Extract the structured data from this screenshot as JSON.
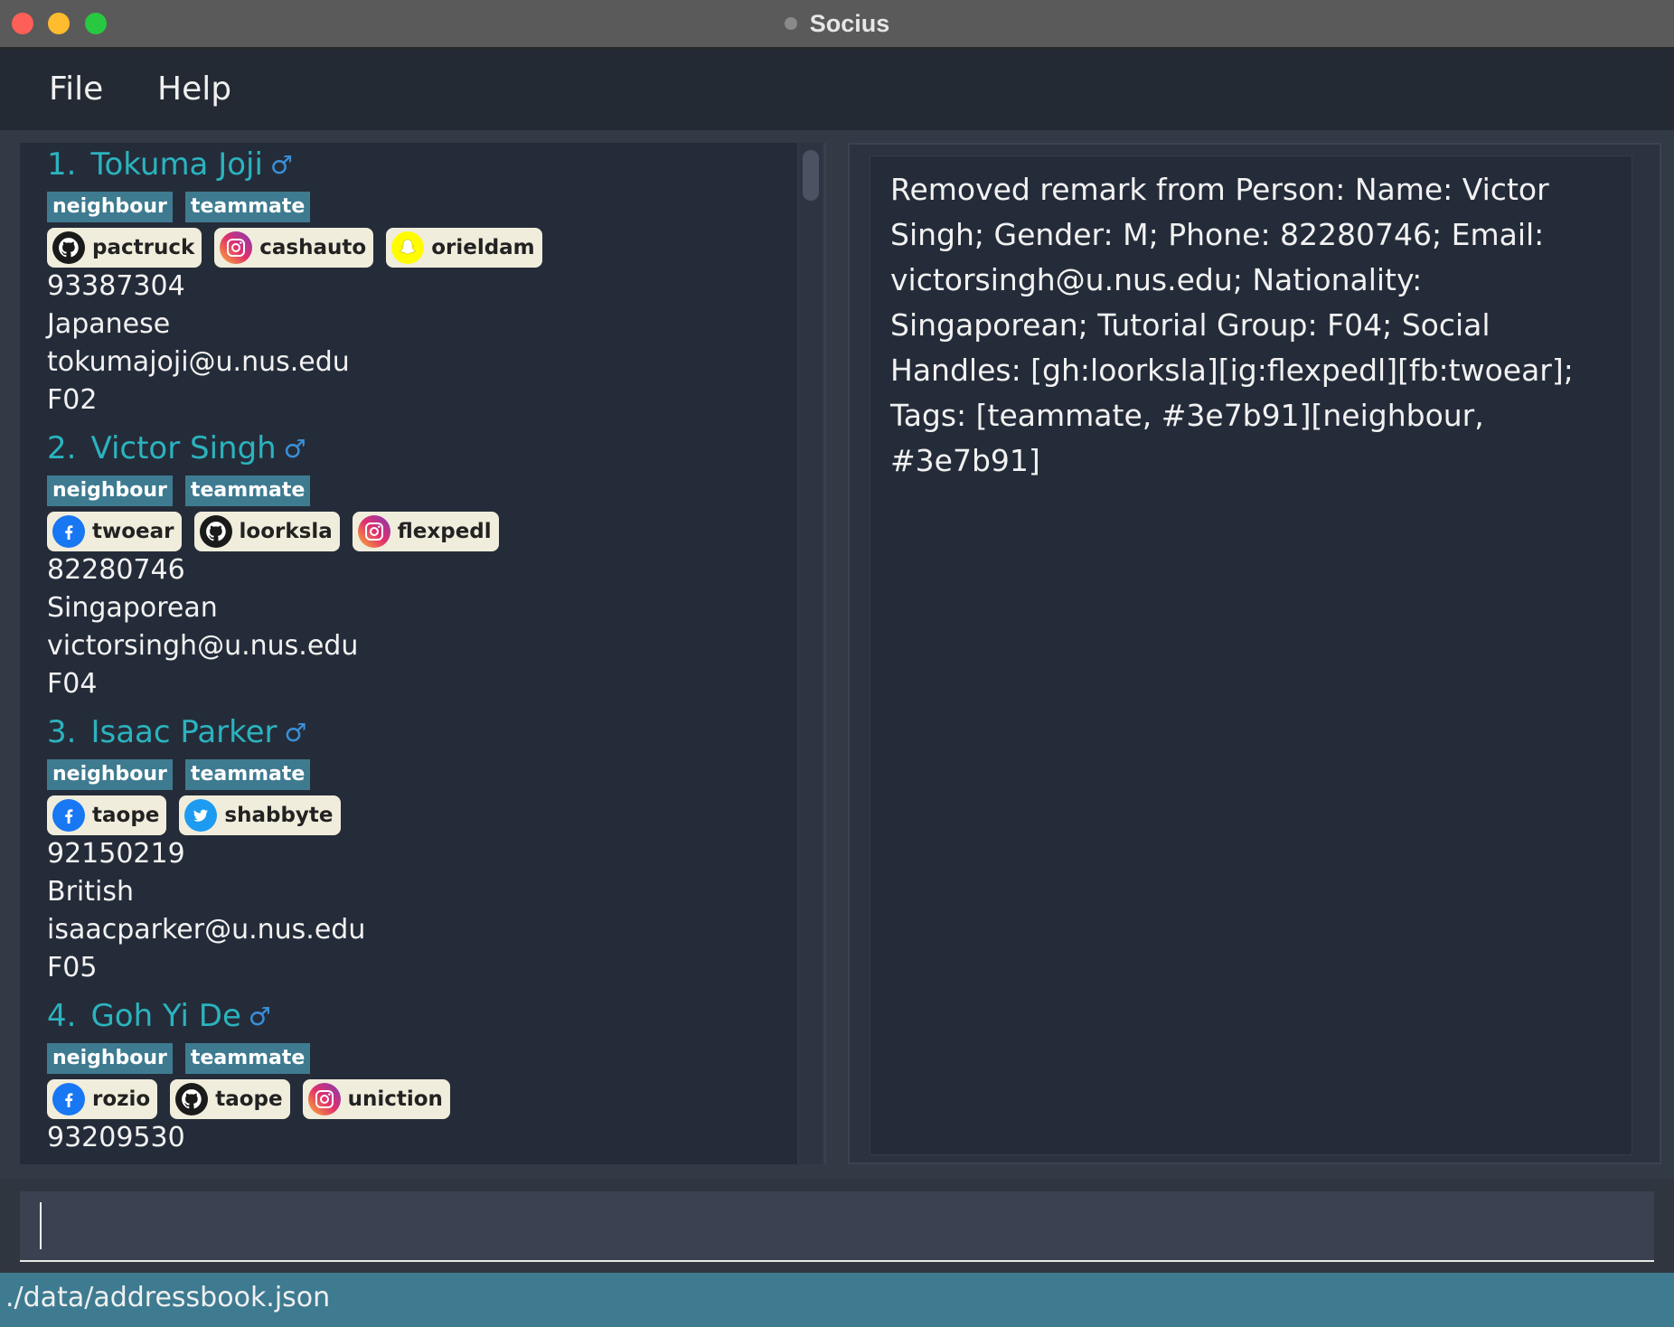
{
  "window": {
    "title": "Socius"
  },
  "menu": {
    "file": "File",
    "help": "Help"
  },
  "persons": [
    {
      "index": "1.",
      "name": "Tokuma Joji",
      "gender_icon": "male-icon",
      "tags": [
        "neighbour",
        "teammate"
      ],
      "socials": [
        {
          "platform": "github",
          "icon": "github-icon",
          "handle": "pactruck"
        },
        {
          "platform": "instagram",
          "icon": "instagram-icon",
          "handle": "cashauto"
        },
        {
          "platform": "snapchat",
          "icon": "snapchat-icon",
          "handle": "orieldam"
        }
      ],
      "phone": "93387304",
      "nationality": "Japanese",
      "email": "tokumajoji@u.nus.edu",
      "tutorial": "F02"
    },
    {
      "index": "2.",
      "name": "Victor Singh",
      "gender_icon": "male-icon",
      "tags": [
        "neighbour",
        "teammate"
      ],
      "socials": [
        {
          "platform": "facebook",
          "icon": "facebook-icon",
          "handle": "twoear"
        },
        {
          "platform": "github",
          "icon": "github-icon",
          "handle": "loorksla"
        },
        {
          "platform": "instagram",
          "icon": "instagram-icon",
          "handle": "flexpedl"
        }
      ],
      "phone": "82280746",
      "nationality": "Singaporean",
      "email": "victorsingh@u.nus.edu",
      "tutorial": "F04"
    },
    {
      "index": "3.",
      "name": "Isaac Parker",
      "gender_icon": "male-icon",
      "tags": [
        "neighbour",
        "teammate"
      ],
      "socials": [
        {
          "platform": "facebook",
          "icon": "facebook-icon",
          "handle": "taope"
        },
        {
          "platform": "twitter",
          "icon": "twitter-icon",
          "handle": "shabbyte"
        }
      ],
      "phone": "92150219",
      "nationality": "British",
      "email": "isaacparker@u.nus.edu",
      "tutorial": "F05"
    },
    {
      "index": "4.",
      "name": "Goh Yi De",
      "gender_icon": "male-icon",
      "tags": [
        "neighbour",
        "teammate"
      ],
      "socials": [
        {
          "platform": "facebook",
          "icon": "facebook-icon",
          "handle": "rozio"
        },
        {
          "platform": "github",
          "icon": "github-icon",
          "handle": "taope"
        },
        {
          "platform": "instagram",
          "icon": "instagram-icon",
          "handle": "uniction"
        }
      ],
      "phone": "93209530"
    }
  ],
  "result": {
    "text": "Removed remark from Person: Name: Victor Singh; Gender: M; Phone: 82280746; Email: victorsingh@u.nus.edu; Nationality: Singaporean; Tutorial Group: F04; Social Handles: [gh:loorksla][ig:flexpedl][fb:twoear]; Tags: [teammate, #3e7b91][neighbour, #3e7b91]"
  },
  "command": {
    "value": ""
  },
  "status": {
    "file_path": "./data/addressbook.json"
  },
  "colors": {
    "tag": "#3e7b91",
    "name": "#2bb3bf",
    "statusbar": "#3e7b91",
    "background": "#252c39"
  }
}
